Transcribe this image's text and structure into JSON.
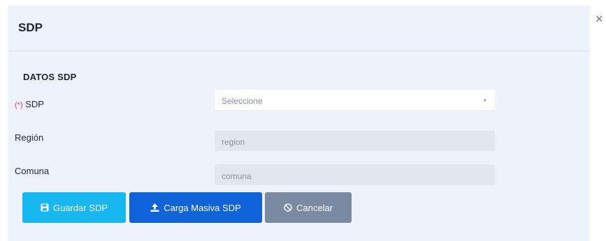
{
  "modal": {
    "title": "SDP",
    "close_glyph": "×"
  },
  "section": {
    "title": "DATOS SDP"
  },
  "fields": {
    "sdp": {
      "required_mark": "(*)",
      "label": "SDP",
      "value": "Seleccione",
      "caret": "▾"
    },
    "region": {
      "label": "Región",
      "placeholder": "region"
    },
    "comuna": {
      "label": "Comuna",
      "placeholder": "comuna"
    }
  },
  "buttons": {
    "save": {
      "label": "Guardar SDP",
      "icon": "save-icon"
    },
    "upload": {
      "label": "Carga Masiva SDP",
      "icon": "upload-icon"
    },
    "cancel": {
      "label": "Cancelar",
      "icon": "ban-icon"
    }
  },
  "colors": {
    "save": "#17b7f0",
    "upload": "#1163d9",
    "cancel": "#7b8aa3",
    "required": "#e0436b",
    "panel": "#eef2fa"
  }
}
